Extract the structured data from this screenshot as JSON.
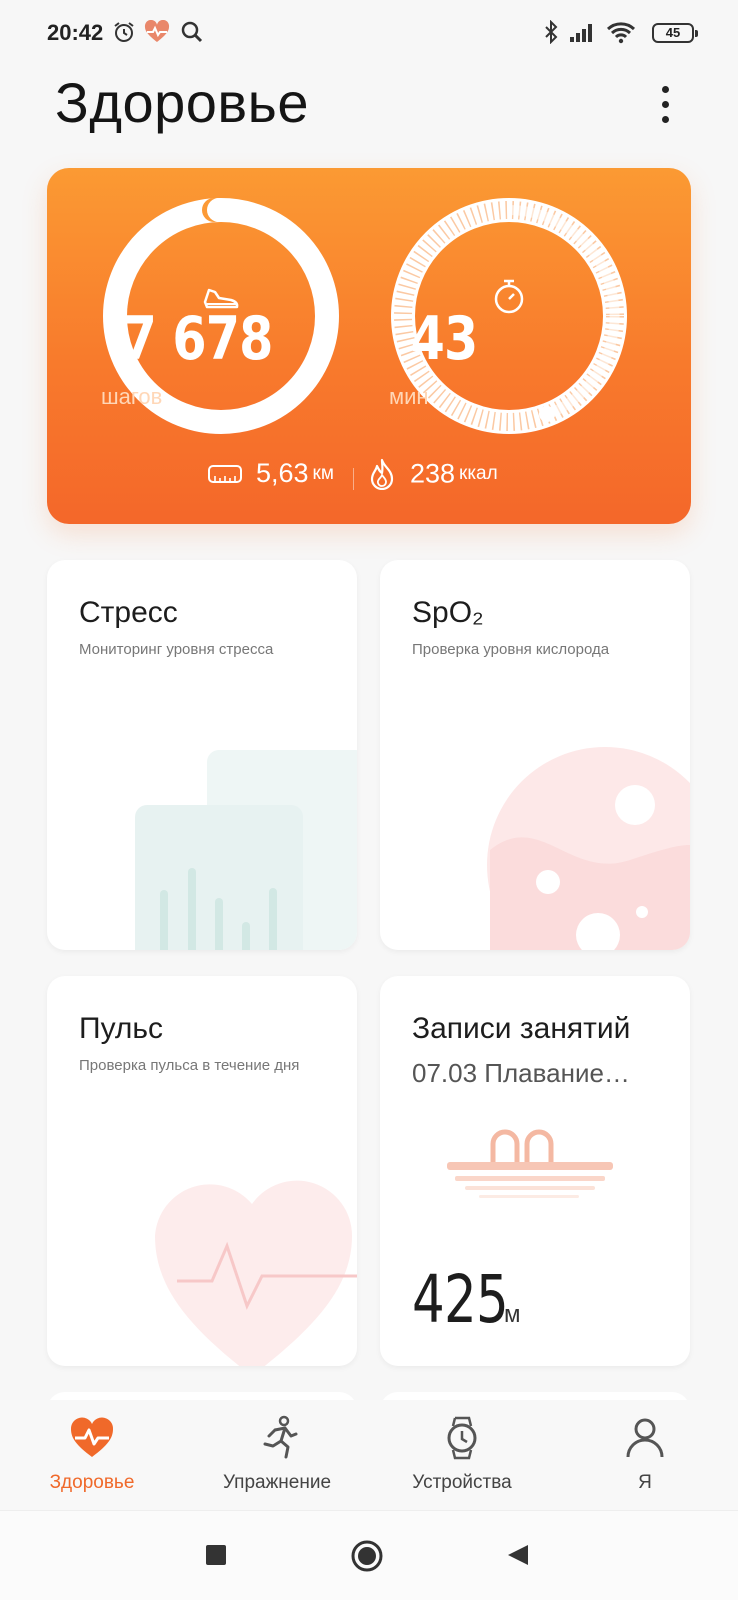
{
  "status_bar": {
    "time": "20:42",
    "icons": [
      "alarm-icon",
      "health-app-icon",
      "search-icon",
      "bluetooth-icon",
      "signal-icon",
      "wifi-icon"
    ],
    "battery": "45"
  },
  "header": {
    "title": "Здоровье",
    "menu_icon": "more-vertical-icon"
  },
  "activity": {
    "steps_value": "7 678",
    "steps_unit": "шагов",
    "active_value": "43",
    "active_unit": "мин",
    "distance_value": "5,63",
    "distance_unit": "км",
    "calories_value": "238",
    "calories_unit": "ккал",
    "accent": "#f87a2c"
  },
  "cards": {
    "stress": {
      "title": "Стресс",
      "desc": "Мониторинг уровня стресса"
    },
    "spo2": {
      "title": "SpO₂",
      "desc": "Проверка уровня кислорода"
    },
    "pulse": {
      "title": "Пульс",
      "desc": "Проверка пульса в течение дня"
    },
    "records": {
      "title": "Записи занятий",
      "subtitle": "07.03 Плавание…",
      "value": "425",
      "unit": "м"
    }
  },
  "nav": {
    "health": "Здоровье",
    "exercise": "Упражнение",
    "devices": "Устройства",
    "me": "Я",
    "active_color": "#f0692a"
  }
}
